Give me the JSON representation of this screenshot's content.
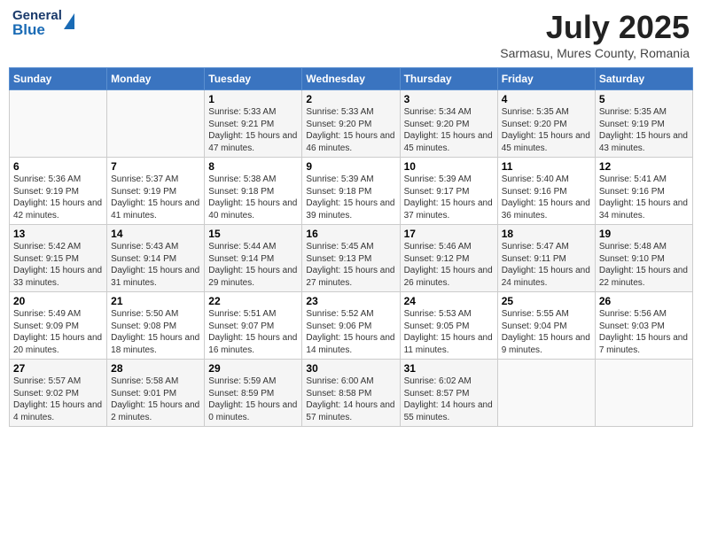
{
  "header": {
    "logo_general": "General",
    "logo_blue": "Blue",
    "month_title": "July 2025",
    "location": "Sarmasu, Mures County, Romania"
  },
  "weekdays": [
    "Sunday",
    "Monday",
    "Tuesday",
    "Wednesday",
    "Thursday",
    "Friday",
    "Saturday"
  ],
  "weeks": [
    [
      {
        "day": "",
        "sunrise": "",
        "sunset": "",
        "daylight": ""
      },
      {
        "day": "",
        "sunrise": "",
        "sunset": "",
        "daylight": ""
      },
      {
        "day": "1",
        "sunrise": "Sunrise: 5:33 AM",
        "sunset": "Sunset: 9:21 PM",
        "daylight": "Daylight: 15 hours and 47 minutes."
      },
      {
        "day": "2",
        "sunrise": "Sunrise: 5:33 AM",
        "sunset": "Sunset: 9:20 PM",
        "daylight": "Daylight: 15 hours and 46 minutes."
      },
      {
        "day": "3",
        "sunrise": "Sunrise: 5:34 AM",
        "sunset": "Sunset: 9:20 PM",
        "daylight": "Daylight: 15 hours and 45 minutes."
      },
      {
        "day": "4",
        "sunrise": "Sunrise: 5:35 AM",
        "sunset": "Sunset: 9:20 PM",
        "daylight": "Daylight: 15 hours and 45 minutes."
      },
      {
        "day": "5",
        "sunrise": "Sunrise: 5:35 AM",
        "sunset": "Sunset: 9:19 PM",
        "daylight": "Daylight: 15 hours and 43 minutes."
      }
    ],
    [
      {
        "day": "6",
        "sunrise": "Sunrise: 5:36 AM",
        "sunset": "Sunset: 9:19 PM",
        "daylight": "Daylight: 15 hours and 42 minutes."
      },
      {
        "day": "7",
        "sunrise": "Sunrise: 5:37 AM",
        "sunset": "Sunset: 9:19 PM",
        "daylight": "Daylight: 15 hours and 41 minutes."
      },
      {
        "day": "8",
        "sunrise": "Sunrise: 5:38 AM",
        "sunset": "Sunset: 9:18 PM",
        "daylight": "Daylight: 15 hours and 40 minutes."
      },
      {
        "day": "9",
        "sunrise": "Sunrise: 5:39 AM",
        "sunset": "Sunset: 9:18 PM",
        "daylight": "Daylight: 15 hours and 39 minutes."
      },
      {
        "day": "10",
        "sunrise": "Sunrise: 5:39 AM",
        "sunset": "Sunset: 9:17 PM",
        "daylight": "Daylight: 15 hours and 37 minutes."
      },
      {
        "day": "11",
        "sunrise": "Sunrise: 5:40 AM",
        "sunset": "Sunset: 9:16 PM",
        "daylight": "Daylight: 15 hours and 36 minutes."
      },
      {
        "day": "12",
        "sunrise": "Sunrise: 5:41 AM",
        "sunset": "Sunset: 9:16 PM",
        "daylight": "Daylight: 15 hours and 34 minutes."
      }
    ],
    [
      {
        "day": "13",
        "sunrise": "Sunrise: 5:42 AM",
        "sunset": "Sunset: 9:15 PM",
        "daylight": "Daylight: 15 hours and 33 minutes."
      },
      {
        "day": "14",
        "sunrise": "Sunrise: 5:43 AM",
        "sunset": "Sunset: 9:14 PM",
        "daylight": "Daylight: 15 hours and 31 minutes."
      },
      {
        "day": "15",
        "sunrise": "Sunrise: 5:44 AM",
        "sunset": "Sunset: 9:14 PM",
        "daylight": "Daylight: 15 hours and 29 minutes."
      },
      {
        "day": "16",
        "sunrise": "Sunrise: 5:45 AM",
        "sunset": "Sunset: 9:13 PM",
        "daylight": "Daylight: 15 hours and 27 minutes."
      },
      {
        "day": "17",
        "sunrise": "Sunrise: 5:46 AM",
        "sunset": "Sunset: 9:12 PM",
        "daylight": "Daylight: 15 hours and 26 minutes."
      },
      {
        "day": "18",
        "sunrise": "Sunrise: 5:47 AM",
        "sunset": "Sunset: 9:11 PM",
        "daylight": "Daylight: 15 hours and 24 minutes."
      },
      {
        "day": "19",
        "sunrise": "Sunrise: 5:48 AM",
        "sunset": "Sunset: 9:10 PM",
        "daylight": "Daylight: 15 hours and 22 minutes."
      }
    ],
    [
      {
        "day": "20",
        "sunrise": "Sunrise: 5:49 AM",
        "sunset": "Sunset: 9:09 PM",
        "daylight": "Daylight: 15 hours and 20 minutes."
      },
      {
        "day": "21",
        "sunrise": "Sunrise: 5:50 AM",
        "sunset": "Sunset: 9:08 PM",
        "daylight": "Daylight: 15 hours and 18 minutes."
      },
      {
        "day": "22",
        "sunrise": "Sunrise: 5:51 AM",
        "sunset": "Sunset: 9:07 PM",
        "daylight": "Daylight: 15 hours and 16 minutes."
      },
      {
        "day": "23",
        "sunrise": "Sunrise: 5:52 AM",
        "sunset": "Sunset: 9:06 PM",
        "daylight": "Daylight: 15 hours and 14 minutes."
      },
      {
        "day": "24",
        "sunrise": "Sunrise: 5:53 AM",
        "sunset": "Sunset: 9:05 PM",
        "daylight": "Daylight: 15 hours and 11 minutes."
      },
      {
        "day": "25",
        "sunrise": "Sunrise: 5:55 AM",
        "sunset": "Sunset: 9:04 PM",
        "daylight": "Daylight: 15 hours and 9 minutes."
      },
      {
        "day": "26",
        "sunrise": "Sunrise: 5:56 AM",
        "sunset": "Sunset: 9:03 PM",
        "daylight": "Daylight: 15 hours and 7 minutes."
      }
    ],
    [
      {
        "day": "27",
        "sunrise": "Sunrise: 5:57 AM",
        "sunset": "Sunset: 9:02 PM",
        "daylight": "Daylight: 15 hours and 4 minutes."
      },
      {
        "day": "28",
        "sunrise": "Sunrise: 5:58 AM",
        "sunset": "Sunset: 9:01 PM",
        "daylight": "Daylight: 15 hours and 2 minutes."
      },
      {
        "day": "29",
        "sunrise": "Sunrise: 5:59 AM",
        "sunset": "Sunset: 8:59 PM",
        "daylight": "Daylight: 15 hours and 0 minutes."
      },
      {
        "day": "30",
        "sunrise": "Sunrise: 6:00 AM",
        "sunset": "Sunset: 8:58 PM",
        "daylight": "Daylight: 14 hours and 57 minutes."
      },
      {
        "day": "31",
        "sunrise": "Sunrise: 6:02 AM",
        "sunset": "Sunset: 8:57 PM",
        "daylight": "Daylight: 14 hours and 55 minutes."
      },
      {
        "day": "",
        "sunrise": "",
        "sunset": "",
        "daylight": ""
      },
      {
        "day": "",
        "sunrise": "",
        "sunset": "",
        "daylight": ""
      }
    ]
  ]
}
